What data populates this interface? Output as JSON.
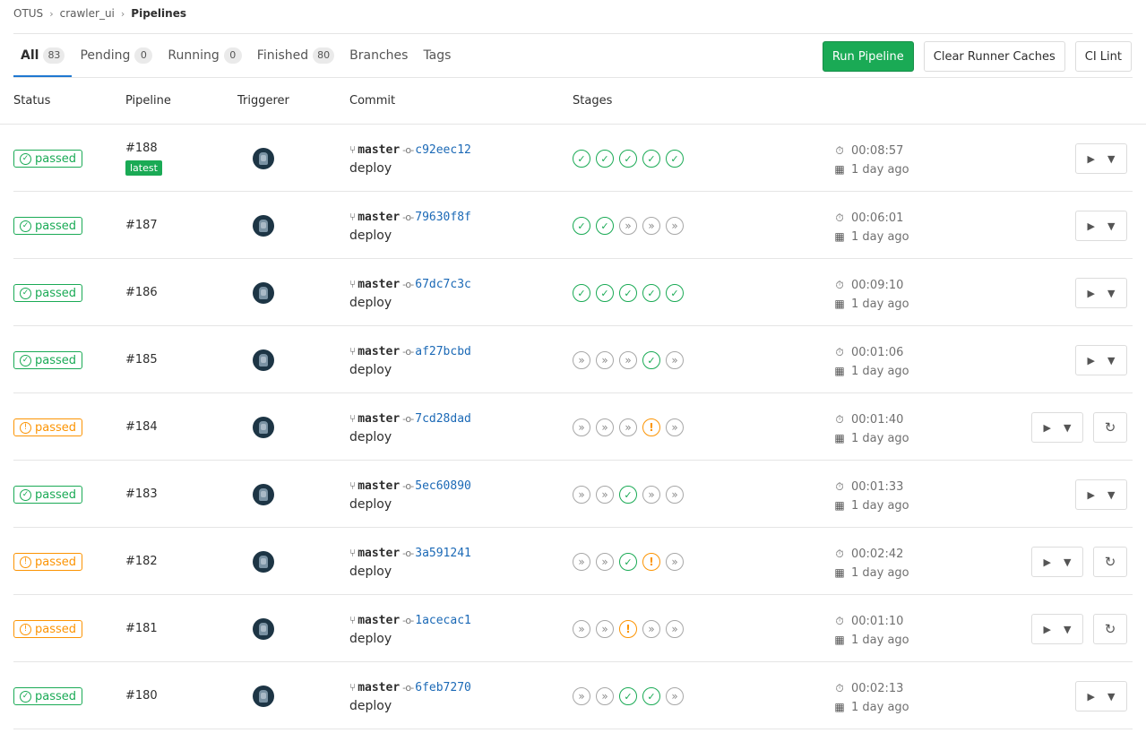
{
  "breadcrumb": [
    "OTUS",
    "crawler_ui",
    "Pipelines"
  ],
  "tabs": [
    {
      "label": "All",
      "count": "83",
      "active": true
    },
    {
      "label": "Pending",
      "count": "0"
    },
    {
      "label": "Running",
      "count": "0"
    },
    {
      "label": "Finished",
      "count": "80"
    },
    {
      "label": "Branches"
    },
    {
      "label": "Tags"
    }
  ],
  "actions": {
    "run": "Run Pipeline",
    "clear": "Clear Runner Caches",
    "lint": "CI Lint"
  },
  "columns": {
    "status": "Status",
    "pipeline": "Pipeline",
    "triggerer": "Triggerer",
    "commit": "Commit",
    "stages": "Stages"
  },
  "colors": {
    "success": "#1aaa55",
    "warning": "#fc9403",
    "link": "#1b69b6",
    "skipped": "#a7a7a7"
  },
  "icons": {
    "branch": "branch-icon",
    "commit": "commit-icon",
    "timer": "timer-icon",
    "calendar": "calendar-icon",
    "play": "play-icon",
    "caret": "caret-down-icon",
    "retry": "retry-icon"
  },
  "pipelines": [
    {
      "status": "success",
      "status_label": "passed",
      "id": "#188",
      "tag": "latest",
      "branch": "master",
      "sha": "c92eec12",
      "message": "deploy",
      "stages": [
        "success",
        "success",
        "success",
        "success",
        "success"
      ],
      "duration": "00:08:57",
      "finished": "1 day ago",
      "retry": false
    },
    {
      "status": "success",
      "status_label": "passed",
      "id": "#187",
      "branch": "master",
      "sha": "79630f8f",
      "message": "deploy",
      "stages": [
        "success",
        "success",
        "skipped",
        "skipped",
        "skipped"
      ],
      "duration": "00:06:01",
      "finished": "1 day ago",
      "retry": false
    },
    {
      "status": "success",
      "status_label": "passed",
      "id": "#186",
      "branch": "master",
      "sha": "67dc7c3c",
      "message": "deploy",
      "stages": [
        "success",
        "success",
        "success",
        "success",
        "success"
      ],
      "duration": "00:09:10",
      "finished": "1 day ago",
      "retry": false
    },
    {
      "status": "success",
      "status_label": "passed",
      "id": "#185",
      "branch": "master",
      "sha": "af27bcbd",
      "message": "deploy",
      "stages": [
        "skipped",
        "skipped",
        "skipped",
        "success",
        "skipped"
      ],
      "duration": "00:01:06",
      "finished": "1 day ago",
      "retry": false
    },
    {
      "status": "warning",
      "status_label": "passed",
      "id": "#184",
      "branch": "master",
      "sha": "7cd28dad",
      "message": "deploy",
      "stages": [
        "skipped",
        "skipped",
        "skipped",
        "warning",
        "skipped"
      ],
      "duration": "00:01:40",
      "finished": "1 day ago",
      "retry": true
    },
    {
      "status": "success",
      "status_label": "passed",
      "id": "#183",
      "branch": "master",
      "sha": "5ec60890",
      "message": "deploy",
      "stages": [
        "skipped",
        "skipped",
        "success",
        "skipped",
        "skipped"
      ],
      "duration": "00:01:33",
      "finished": "1 day ago",
      "retry": false
    },
    {
      "status": "warning",
      "status_label": "passed",
      "id": "#182",
      "branch": "master",
      "sha": "3a591241",
      "message": "deploy",
      "stages": [
        "skipped",
        "skipped",
        "success",
        "warning",
        "skipped"
      ],
      "duration": "00:02:42",
      "finished": "1 day ago",
      "retry": true
    },
    {
      "status": "warning",
      "status_label": "passed",
      "id": "#181",
      "branch": "master",
      "sha": "1acecac1",
      "message": "deploy",
      "stages": [
        "skipped",
        "skipped",
        "warning",
        "skipped",
        "skipped"
      ],
      "duration": "00:01:10",
      "finished": "1 day ago",
      "retry": true
    },
    {
      "status": "success",
      "status_label": "passed",
      "id": "#180",
      "branch": "master",
      "sha": "6feb7270",
      "message": "deploy",
      "stages": [
        "skipped",
        "skipped",
        "success",
        "success",
        "skipped"
      ],
      "duration": "00:02:13",
      "finished": "1 day ago",
      "retry": false
    }
  ]
}
